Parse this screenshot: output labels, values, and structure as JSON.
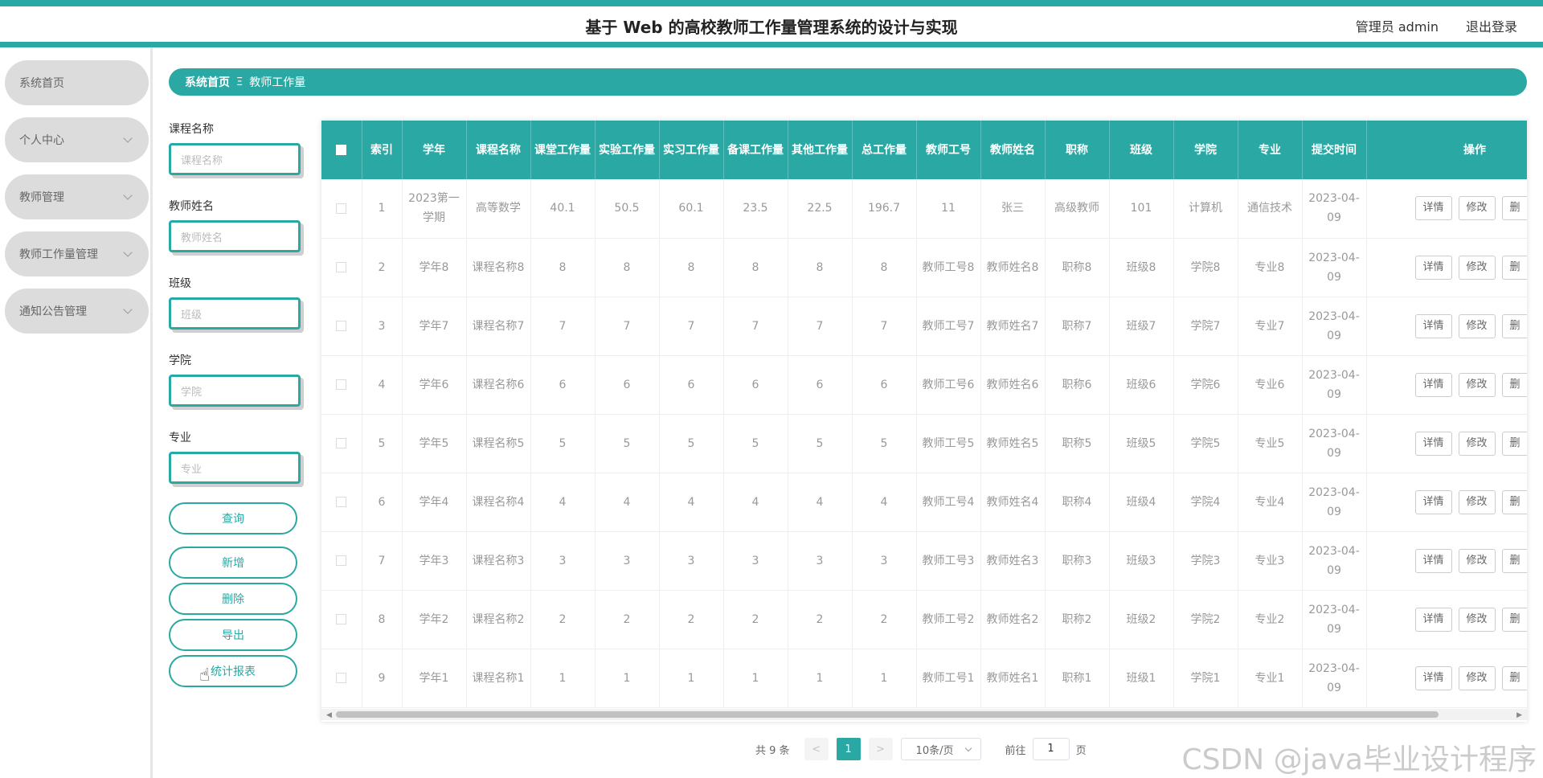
{
  "header": {
    "title": "基于 Web 的高校教师工作量管理系统的设计与实现",
    "admin": "管理员 admin",
    "logout": "退出登录"
  },
  "sidebar": {
    "items": [
      {
        "label": "系统首页",
        "has_arrow": false
      },
      {
        "label": "个人中心",
        "has_arrow": true
      },
      {
        "label": "教师管理",
        "has_arrow": true
      },
      {
        "label": "教师工作量管理",
        "has_arrow": true
      },
      {
        "label": "通知公告管理",
        "has_arrow": true
      }
    ]
  },
  "breadcrumb": {
    "home": "系统首页",
    "separator": "Ξ",
    "current": "教师工作量"
  },
  "search": {
    "course_label": "课程名称",
    "course_placeholder": "课程名称",
    "teacher_label": "教师姓名",
    "teacher_placeholder": "教师姓名",
    "class_label": "班级",
    "class_placeholder": "班级",
    "college_label": "学院",
    "college_placeholder": "学院",
    "major_label": "专业",
    "major_placeholder": "专业",
    "query_button": "查询"
  },
  "actions": {
    "add": "新增",
    "delete": "删除",
    "export": "导出",
    "report": "统计报表"
  },
  "table": {
    "columns": [
      "索引",
      "学年",
      "课程名称",
      "课堂工作量",
      "实验工作量",
      "实习工作量",
      "备课工作量",
      "其他工作量",
      "总工作量",
      "教师工号",
      "教师姓名",
      "职称",
      "班级",
      "学院",
      "专业",
      "提交时间",
      "操作"
    ],
    "row_actions": {
      "detail": "详情",
      "edit": "修改",
      "delete": "删"
    },
    "rows": [
      {
        "index": "1",
        "year": "2023第一学期",
        "course": "高等数学",
        "classroom": "40.1",
        "lab": "50.5",
        "intern": "60.1",
        "prep": "23.5",
        "other": "22.5",
        "total": "196.7",
        "teacher_no": "11",
        "teacher_name": "张三",
        "title": "高级教师",
        "class": "101",
        "college": "计算机",
        "major": "通信技术",
        "time": "2023-04-09"
      },
      {
        "index": "2",
        "year": "学年8",
        "course": "课程名称8",
        "classroom": "8",
        "lab": "8",
        "intern": "8",
        "prep": "8",
        "other": "8",
        "total": "8",
        "teacher_no": "教师工号8",
        "teacher_name": "教师姓名8",
        "title": "职称8",
        "class": "班级8",
        "college": "学院8",
        "major": "专业8",
        "time": "2023-04-09"
      },
      {
        "index": "3",
        "year": "学年7",
        "course": "课程名称7",
        "classroom": "7",
        "lab": "7",
        "intern": "7",
        "prep": "7",
        "other": "7",
        "total": "7",
        "teacher_no": "教师工号7",
        "teacher_name": "教师姓名7",
        "title": "职称7",
        "class": "班级7",
        "college": "学院7",
        "major": "专业7",
        "time": "2023-04-09"
      },
      {
        "index": "4",
        "year": "学年6",
        "course": "课程名称6",
        "classroom": "6",
        "lab": "6",
        "intern": "6",
        "prep": "6",
        "other": "6",
        "total": "6",
        "teacher_no": "教师工号6",
        "teacher_name": "教师姓名6",
        "title": "职称6",
        "class": "班级6",
        "college": "学院6",
        "major": "专业6",
        "time": "2023-04-09"
      },
      {
        "index": "5",
        "year": "学年5",
        "course": "课程名称5",
        "classroom": "5",
        "lab": "5",
        "intern": "5",
        "prep": "5",
        "other": "5",
        "total": "5",
        "teacher_no": "教师工号5",
        "teacher_name": "教师姓名5",
        "title": "职称5",
        "class": "班级5",
        "college": "学院5",
        "major": "专业5",
        "time": "2023-04-09"
      },
      {
        "index": "6",
        "year": "学年4",
        "course": "课程名称4",
        "classroom": "4",
        "lab": "4",
        "intern": "4",
        "prep": "4",
        "other": "4",
        "total": "4",
        "teacher_no": "教师工号4",
        "teacher_name": "教师姓名4",
        "title": "职称4",
        "class": "班级4",
        "college": "学院4",
        "major": "专业4",
        "time": "2023-04-09"
      },
      {
        "index": "7",
        "year": "学年3",
        "course": "课程名称3",
        "classroom": "3",
        "lab": "3",
        "intern": "3",
        "prep": "3",
        "other": "3",
        "total": "3",
        "teacher_no": "教师工号3",
        "teacher_name": "教师姓名3",
        "title": "职称3",
        "class": "班级3",
        "college": "学院3",
        "major": "专业3",
        "time": "2023-04-09"
      },
      {
        "index": "8",
        "year": "学年2",
        "course": "课程名称2",
        "classroom": "2",
        "lab": "2",
        "intern": "2",
        "prep": "2",
        "other": "2",
        "total": "2",
        "teacher_no": "教师工号2",
        "teacher_name": "教师姓名2",
        "title": "职称2",
        "class": "班级2",
        "college": "学院2",
        "major": "专业2",
        "time": "2023-04-09"
      },
      {
        "index": "9",
        "year": "学年1",
        "course": "课程名称1",
        "classroom": "1",
        "lab": "1",
        "intern": "1",
        "prep": "1",
        "other": "1",
        "total": "1",
        "teacher_no": "教师工号1",
        "teacher_name": "教师姓名1",
        "title": "职称1",
        "class": "班级1",
        "college": "学院1",
        "major": "专业1",
        "time": "2023-04-09"
      }
    ]
  },
  "pagination": {
    "total_text": "共 9 条",
    "prev": "<",
    "current_page": "1",
    "next": ">",
    "page_size": "10条/页",
    "goto_label": "前往",
    "goto_value": "1",
    "page_suffix": "页"
  },
  "watermark": "CSDN @java毕业设计程序",
  "colors": {
    "accent": "#2aa8a3",
    "sidebar_item": "#dcdcdc"
  }
}
